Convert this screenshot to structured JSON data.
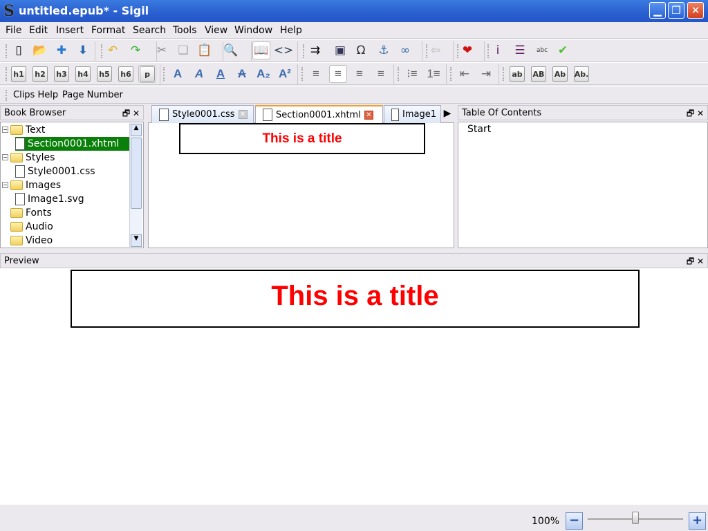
{
  "window": {
    "title": "untitled.epub* - Sigil",
    "app_icon": "S",
    "minimize": "▁",
    "restore": "❐",
    "close": "✕"
  },
  "menu": [
    "File",
    "Edit",
    "Insert",
    "Format",
    "Search",
    "Tools",
    "View",
    "Window",
    "Help"
  ],
  "toolbar1": [
    {
      "icon": "new-file-icon",
      "glyph": "▯"
    },
    {
      "icon": "open-folder-icon",
      "glyph": "📂"
    },
    {
      "icon": "add-file-icon",
      "glyph": "✚"
    },
    {
      "icon": "save-icon",
      "glyph": "⬇"
    },
    {
      "icon": "undo-icon",
      "glyph": "↶"
    },
    {
      "icon": "redo-icon",
      "glyph": "↷"
    },
    {
      "icon": "cut-icon",
      "glyph": "✂"
    },
    {
      "icon": "copy-icon",
      "glyph": "❏"
    },
    {
      "icon": "paste-icon",
      "glyph": "📋"
    },
    {
      "icon": "find-replace-icon",
      "glyph": "🔍"
    },
    {
      "icon": "book-view-icon",
      "glyph": "📖",
      "active": true
    },
    {
      "icon": "code-view-icon",
      "glyph": "<>"
    },
    {
      "icon": "split-chapter-icon",
      "glyph": "⇉"
    },
    {
      "icon": "insert-image-icon",
      "glyph": "▣"
    },
    {
      "icon": "special-character-icon",
      "glyph": "Ω"
    },
    {
      "icon": "anchor-icon",
      "glyph": "⚓"
    },
    {
      "icon": "link-icon",
      "glyph": "∞"
    },
    {
      "icon": "back-arrow-icon",
      "glyph": "⇦"
    },
    {
      "icon": "heart-icon",
      "glyph": "❤"
    },
    {
      "icon": "metadata-icon",
      "glyph": "i"
    },
    {
      "icon": "toc-icon",
      "glyph": "☰"
    },
    {
      "icon": "spellcheck-icon",
      "glyph": "abc"
    },
    {
      "icon": "validate-icon",
      "glyph": "✔"
    }
  ],
  "toolbar2": [
    {
      "icon": "h1-button",
      "label": "h1"
    },
    {
      "icon": "h2-button",
      "label": "h2"
    },
    {
      "icon": "h3-button",
      "label": "h3"
    },
    {
      "icon": "h4-button",
      "label": "h4"
    },
    {
      "icon": "h5-button",
      "label": "h5"
    },
    {
      "icon": "h6-button",
      "label": "h6"
    },
    {
      "icon": "paragraph-button",
      "label": "p",
      "active": true
    },
    {
      "icon": "bold-icon",
      "glyph": "A"
    },
    {
      "icon": "italic-icon",
      "glyph": "A"
    },
    {
      "icon": "underline-icon",
      "glyph": "A"
    },
    {
      "icon": "strikethrough-icon",
      "glyph": "A"
    },
    {
      "icon": "subscript-icon",
      "glyph": "A₂"
    },
    {
      "icon": "superscript-icon",
      "glyph": "A²"
    },
    {
      "icon": "align-left-icon",
      "glyph": "≡"
    },
    {
      "icon": "align-center-icon",
      "glyph": "≡",
      "active": true
    },
    {
      "icon": "align-right-icon",
      "glyph": "≡"
    },
    {
      "icon": "justify-icon",
      "glyph": "≡"
    },
    {
      "icon": "bullet-list-icon",
      "glyph": "⁝≡"
    },
    {
      "icon": "numbered-list-icon",
      "glyph": "1≡"
    },
    {
      "icon": "decrease-indent-icon",
      "glyph": "⇤"
    },
    {
      "icon": "increase-indent-icon",
      "glyph": "⇥"
    },
    {
      "icon": "lowercase-button",
      "label": "ab"
    },
    {
      "icon": "uppercase-button",
      "label": "AB"
    },
    {
      "icon": "titlecase-button",
      "label": "Ab"
    },
    {
      "icon": "sentence-case-button",
      "label": "Ab."
    }
  ],
  "toolbar3": {
    "clips_help": "Clips Help",
    "page_number": "Page Number"
  },
  "book_browser": {
    "title": "Book Browser",
    "float": "🗗",
    "close": "✕",
    "items": [
      {
        "label": "Text",
        "type": "folder"
      },
      {
        "label": "Section0001.xhtml",
        "type": "file",
        "selected": true
      },
      {
        "label": "Styles",
        "type": "folder"
      },
      {
        "label": "Style0001.css",
        "type": "file"
      },
      {
        "label": "Images",
        "type": "folder"
      },
      {
        "label": "Image1.svg",
        "type": "file"
      },
      {
        "label": "Fonts",
        "type": "folder"
      },
      {
        "label": "Audio",
        "type": "folder"
      },
      {
        "label": "Video",
        "type": "folder"
      }
    ]
  },
  "tabs": [
    {
      "label": "Style0001.css"
    },
    {
      "label": "Section0001.xhtml",
      "active": true
    },
    {
      "label": "Image1"
    }
  ],
  "editor": {
    "title_text": "This is a title"
  },
  "toc": {
    "title": "Table Of Contents",
    "items": [
      "Start"
    ]
  },
  "preview": {
    "title": "Preview",
    "title_text": "This is a title"
  },
  "status": {
    "zoom": "100%",
    "zoom_out": "−",
    "zoom_in": "+",
    "zoom_level_percent": 100
  }
}
